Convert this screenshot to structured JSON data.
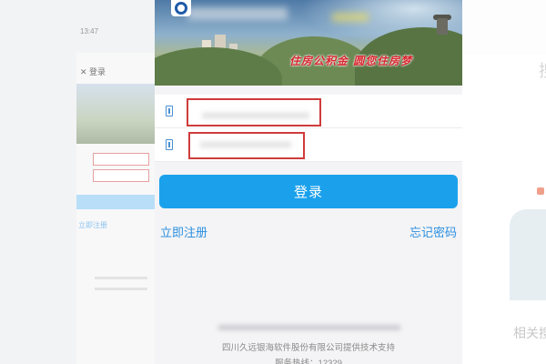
{
  "header": {
    "slogan": "住房公积金 圆您住房梦"
  },
  "form": {
    "username": {
      "value": "",
      "placeholder": ""
    },
    "password": {
      "value": "",
      "placeholder": ""
    }
  },
  "actions": {
    "login_label": "登录",
    "register_label": "立即注册",
    "forgot_label": "忘记密码"
  },
  "footer": {
    "tech_support": "四川久远银海软件股份有限公司提供技术支持",
    "hotline": "服务热线：12329"
  },
  "background_left": {
    "time": "13:47",
    "close_label": "✕ 登录",
    "login_label": "",
    "register_label": "立即注册"
  },
  "background_right": {
    "char": "搜",
    "label": "相关搜"
  },
  "colors": {
    "primary_button": "#1ba1ec",
    "link": "#2a8fe0",
    "highlight_border": "#cf3b3b",
    "slogan": "#d8262e",
    "logo": "#1e5aa8"
  },
  "icons": {
    "field_icon": "phone-icon",
    "logo": "logo-icon"
  }
}
